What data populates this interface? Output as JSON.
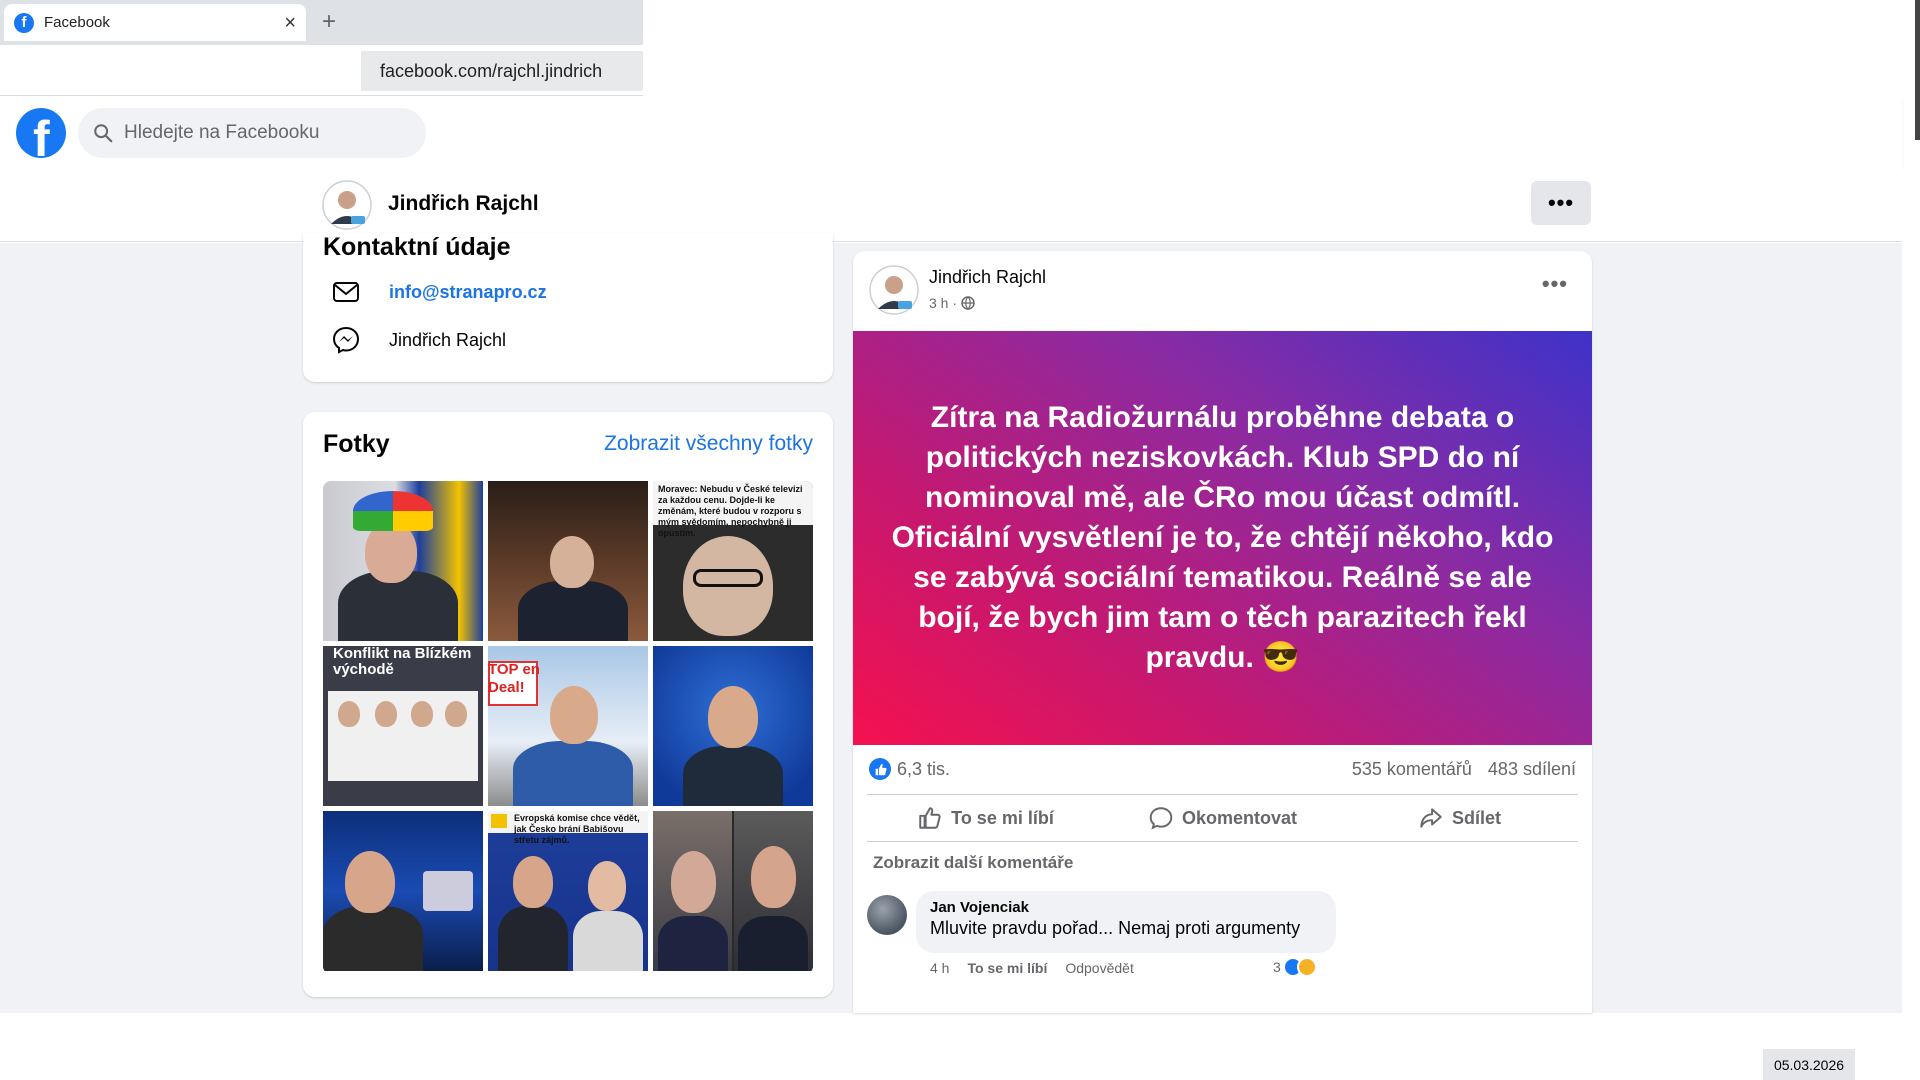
{
  "browser": {
    "tab_title": "Facebook",
    "tab_close": "×",
    "new_tab": "+",
    "address": "facebook.com/rajchl.jindrich",
    "favicon_letter": "f"
  },
  "header": {
    "logo_letter": "f",
    "search_placeholder": "Hledejte na Facebooku",
    "brand_color": "#1877f2"
  },
  "profile": {
    "name": "Jindřich Rajchl",
    "more": "•••",
    "avatar_badge": "PRO"
  },
  "contact": {
    "title": "Kontaktní údaje",
    "email": "info@stranapro.cz",
    "messenger": "Jindřich Rajchl"
  },
  "photos": {
    "title": "Fotky",
    "see_all": "Zobrazit všechny fotky",
    "captions": {
      "p3": "Moravec: Nebudu v České televizi za každou cenu. Dojde-li ke změnám, které budou v rozporu s mým svědomím, nepochybně ji opustím.",
      "p4": "Konflikt na Blízkém východě",
      "p5": "TOP en Deal!",
      "p8": "Evropská komise chce vědět, jak Česko brání Babišovu střetu zájmů."
    }
  },
  "post": {
    "author": "Jindřich Rajchl",
    "time": "3 h ·",
    "more": "•••",
    "text": "Zítra na Radiožurnálu proběhne debata o politických neziskovkách. Klub SPD do ní nominoval mě, ale ČRo mou účast odmítl. Oficiální vysvětlení je to, že chtějí někoho, kdo se zabývá sociální tematikou. Reálně se ale bojí, že bych jim tam o těch parazitech řekl pravdu. 😎",
    "likes": "6,3 tis.",
    "comments": "535 komentářů",
    "shares": "483 sdílení",
    "actions": {
      "like": "To se mi líbí",
      "comment": "Okomentovat",
      "share": "Sdílet"
    },
    "more_comments": "Zobrazit další komentáře",
    "comment": {
      "author": "Jan Vojenciak",
      "text": "Mluvite pravdu pořad... Nemaj proti argumenty",
      "time": "4 h",
      "like": "To se mi líbí",
      "reply": "Odpovědět",
      "reactions": "3"
    }
  },
  "datestamp": "05.03.2026"
}
